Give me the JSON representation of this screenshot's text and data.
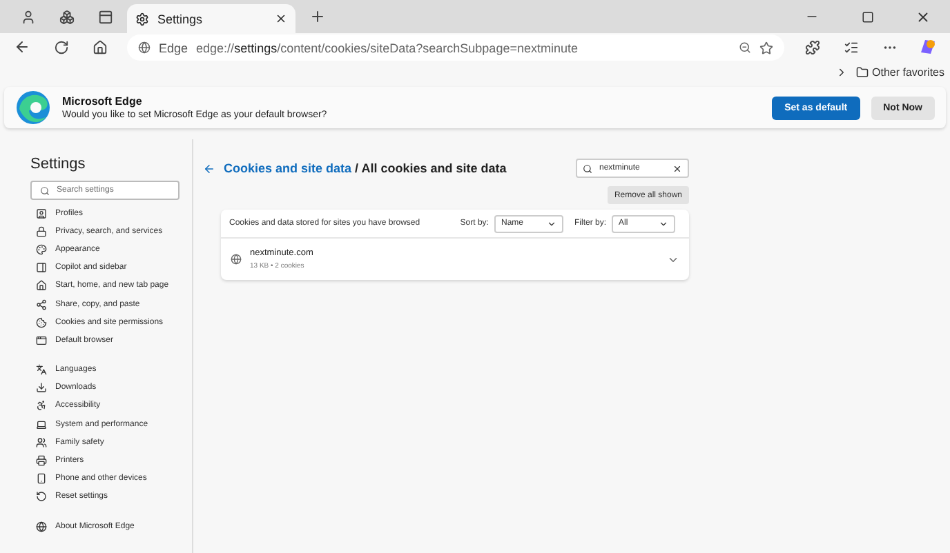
{
  "tabs": [
    {
      "label": "Settings",
      "selected": true
    }
  ],
  "address": {
    "site_label": "Edge",
    "url": "edge://**settings**/content/cookies/siteData?searchSubpage=nextminute"
  },
  "favorites": {
    "folder": "Other favorites"
  },
  "banner": {
    "title": "Microsoft Edge",
    "message": "Would you like to set Microsoft Edge as your default browser?",
    "buttons": [
      {
        "label": "Set as default",
        "kind": "primary"
      },
      {
        "label": "Not Now",
        "kind": "secondary"
      }
    ]
  },
  "sidebar": {
    "title": "Settings",
    "search_placeholder": "Search settings",
    "groups": [
      {
        "items": [
          {
            "label": "Profiles"
          },
          {
            "label": "Privacy, search, and services"
          },
          {
            "label": "Appearance"
          },
          {
            "label": "Copilot and sidebar"
          },
          {
            "label": "Start, home, and new tab page"
          },
          {
            "label": "Share, copy, and paste"
          },
          {
            "label": "Cookies and site permissions"
          },
          {
            "label": "Default browser"
          }
        ]
      },
      {
        "items": [
          {
            "label": "Languages"
          },
          {
            "label": "Downloads"
          },
          {
            "label": "Accessibility"
          },
          {
            "label": "System and performance"
          },
          {
            "label": "Family safety"
          },
          {
            "label": "Printers"
          },
          {
            "label": "Phone and other devices"
          },
          {
            "label": "Reset settings"
          }
        ]
      },
      {
        "items": [
          {
            "label": "About Microsoft Edge"
          }
        ]
      }
    ]
  },
  "main": {
    "breadcrumb_link": "Cookies and site data",
    "breadcrumb_rest": "/ All cookies and site data",
    "search_value": "nextminute",
    "remove_button": "Remove all shown",
    "card": {
      "heading": "Cookies and data stored for sites you have browsed",
      "sort_label": "Sort by:",
      "sort_value": "Name",
      "filter_label": "Filter by:",
      "filter_value": "All",
      "sites": [
        {
          "name": "nextminute.com",
          "detail": "13 KB • 2 cookies",
          "expanded": false
        }
      ]
    }
  }
}
